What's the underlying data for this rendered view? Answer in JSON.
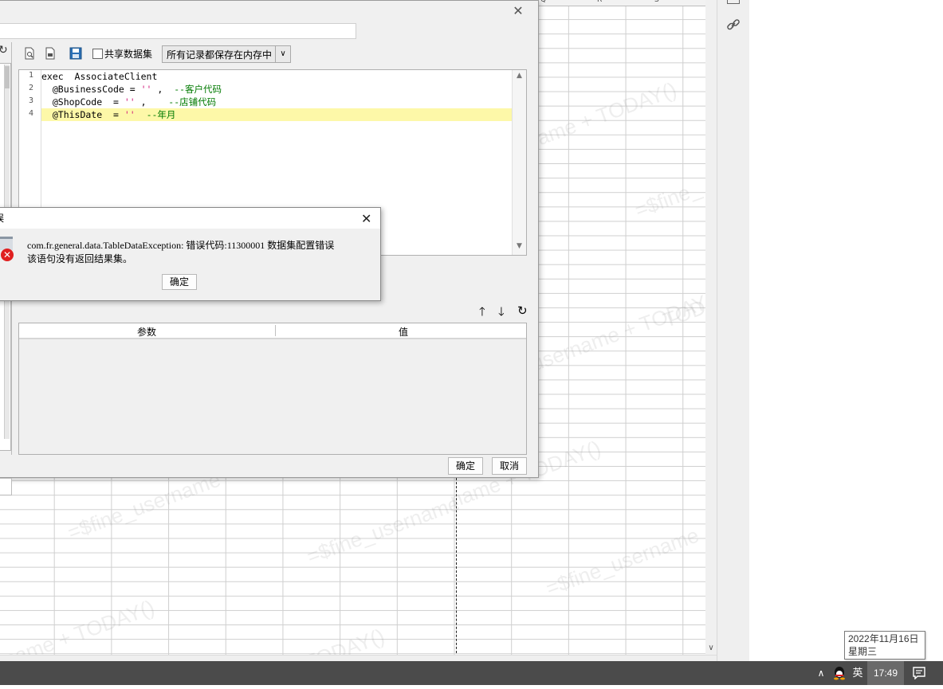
{
  "sheet": {
    "col_headers": [
      "Q",
      "R",
      "S"
    ],
    "watermarks": [
      "name + TODAY()",
      "=$fine_",
      "TODAY()",
      "username + TODAY()",
      "=$fine_username",
      "name + TODAY()",
      "=$fine_username",
      "=$fine_username",
      "name + TODAY()",
      "TODAY()"
    ]
  },
  "main_dialog": {
    "share_dataset_label": "共享数据集",
    "storage_mode_select": "所有记录都保存在内存中",
    "sql_lines": [
      {
        "n": "1",
        "parts": [
          {
            "t": "exec  AssociateClient",
            "c": "kw"
          }
        ]
      },
      {
        "n": "2",
        "parts": [
          {
            "t": "  @BusinessCode = ",
            "c": "var"
          },
          {
            "t": "''",
            "c": "str"
          },
          {
            "t": " ,  ",
            "c": "var"
          },
          {
            "t": "--客户代码",
            "c": "cm"
          }
        ]
      },
      {
        "n": "3",
        "parts": [
          {
            "t": "  @ShopCode  = ",
            "c": "var"
          },
          {
            "t": "''",
            "c": "str"
          },
          {
            "t": " ,    ",
            "c": "var"
          },
          {
            "t": "--店铺代码",
            "c": "cm"
          }
        ]
      },
      {
        "n": "4",
        "parts": [
          {
            "t": "  @ThisDate  = ",
            "c": "var"
          },
          {
            "t": "''",
            "c": "str"
          },
          {
            "t": "  ",
            "c": "var"
          },
          {
            "t": "--年月",
            "c": "cm"
          }
        ]
      }
    ],
    "param_table": {
      "col_param": "参数",
      "col_value": "值"
    },
    "ok_label": "确定",
    "cancel_label": "取消"
  },
  "error_dialog": {
    "title": "误",
    "message_line1": "com.fr.general.data.TableDataException: 错误代码:11300001 数据集配置错误",
    "message_line2": "该语句没有返回结果集。",
    "ok_label": "确定"
  },
  "tooltip": {
    "date": "2022年11月16日",
    "weekday": "星期三"
  },
  "taskbar": {
    "ime": "英",
    "time": "17:49"
  },
  "colors": {
    "error_red": "#e02020",
    "highlight_line": "#fdf8a8",
    "comment_green": "#007a00",
    "string_pink": "#d21b7a",
    "taskbar_bg": "#4b4b4b"
  }
}
